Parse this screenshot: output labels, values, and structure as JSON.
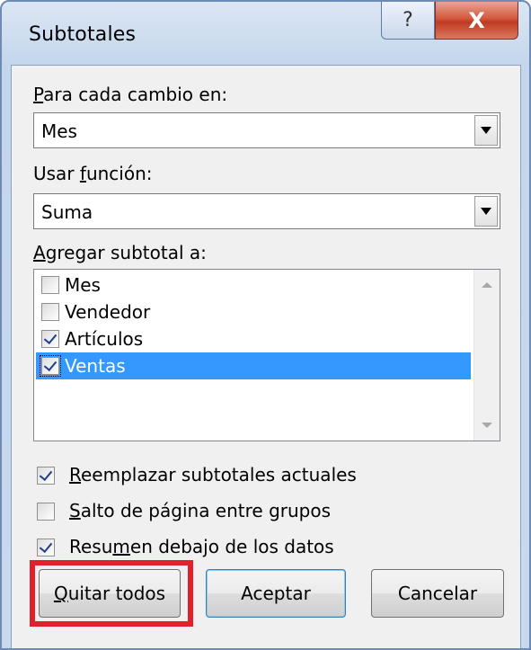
{
  "window": {
    "title": "Subtotales",
    "help_glyph": "?",
    "close_glyph": "X"
  },
  "group_by": {
    "label_prefix": "",
    "label_accel": "P",
    "label_rest": "ara cada cambio en:",
    "value": "Mes"
  },
  "function": {
    "label_prefix": "Usar ",
    "label_accel": "f",
    "label_rest": "unción:",
    "value": "Suma"
  },
  "subtotal_list": {
    "label_prefix": "",
    "label_accel": "A",
    "label_rest": "gregar subtotal a:",
    "items": [
      {
        "label": "Mes",
        "checked": false,
        "selected": false
      },
      {
        "label": "Vendedor",
        "checked": false,
        "selected": false
      },
      {
        "label": "Artículos",
        "checked": true,
        "selected": false
      },
      {
        "label": "Ventas",
        "checked": true,
        "selected": true
      }
    ]
  },
  "options": [
    {
      "prefix": "",
      "accel": "R",
      "rest": "eemplazar subtotales actuales",
      "checked": true
    },
    {
      "prefix": "",
      "accel": "S",
      "rest": "alto de página entre grupos",
      "checked": false
    },
    {
      "prefix": "Resu",
      "accel": "m",
      "rest": "en debajo de los datos",
      "checked": true
    }
  ],
  "buttons": {
    "remove_all": {
      "prefix": "",
      "accel": "Q",
      "rest": "uitar todos"
    },
    "ok": "Aceptar",
    "cancel": "Cancelar"
  },
  "colors": {
    "selection": "#3399ff",
    "highlight": "#e0202a"
  }
}
